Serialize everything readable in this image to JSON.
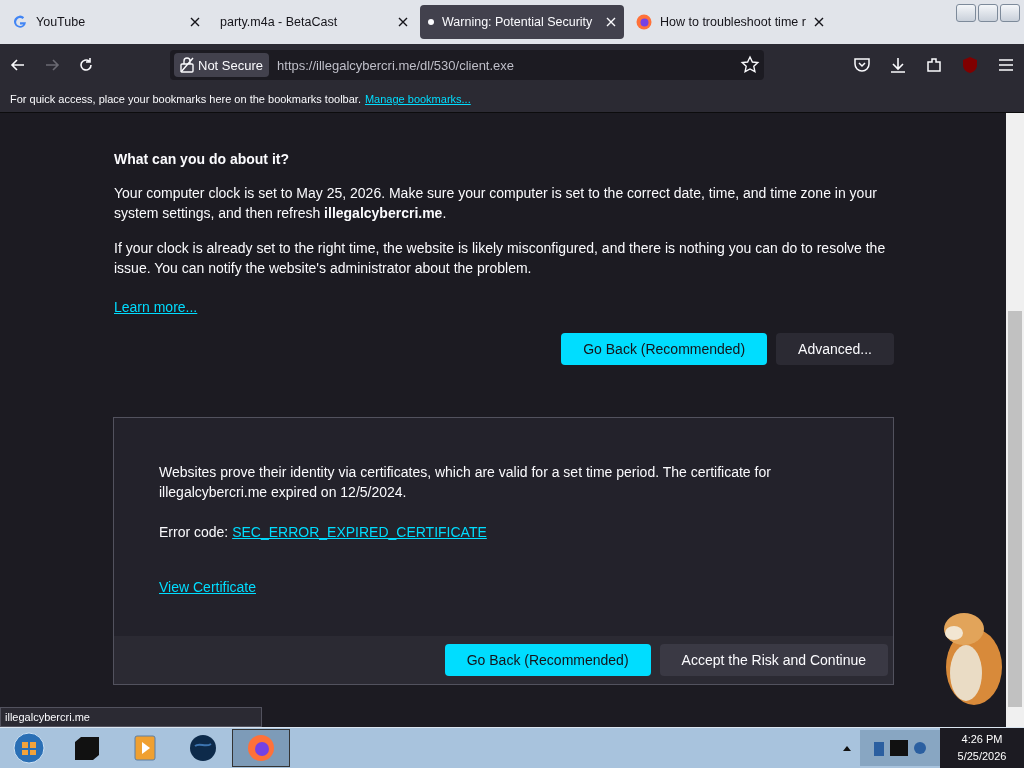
{
  "tabs": [
    {
      "title": "YouTube",
      "kind": "google",
      "selected": false
    },
    {
      "title": "party.m4a - BetaCast",
      "kind": "plain",
      "selected": false
    },
    {
      "title": "Warning: Potential Security",
      "kind": "dot",
      "selected": true
    },
    {
      "title": "How to troubleshoot time r",
      "kind": "firefox",
      "selected": false
    }
  ],
  "toolbar": {
    "security_label": "Not Secure",
    "url": "https://illegalcybercri.me/dl/530/client.exe"
  },
  "bookmarks_bar": {
    "message": "For quick access, place your bookmarks here on the bookmarks toolbar.",
    "link": "Manage bookmarks..."
  },
  "page": {
    "heading": "What can you do about it?",
    "paragraphs": [
      "Your computer clock is set to May 25, 2026. Make sure your computer is set to the correct date, time, and time zone in your system settings, and then refresh **illegalcybercri.me**.",
      "If your clock is already set to the right time, the website is likely misconfigured, and there is nothing you can do to resolve the issue. You can notify the website's administrator about the problem."
    ],
    "learn_more": "Learn more...",
    "buttons": [
      "Go Back (Recommended)",
      "Advanced..."
    ],
    "advanced": {
      "text": "Websites prove their identity via certificates, which are valid for a set time period. The certificate for illegalcybercri.me expired on 12/5/2024.",
      "error_label": "Error code:",
      "error_code": "SEC_ERROR_EXPIRED_CERTIFICATE",
      "view_certificate": "View Certificate",
      "buttons": [
        "Go Back (Recommended)",
        "Accept the Risk and Continue"
      ]
    }
  },
  "status_url": "illegalcybercri.me",
  "taskbar": {
    "apps": [
      {
        "kind": "start"
      },
      {
        "kind": "box"
      },
      {
        "kind": "player"
      },
      {
        "kind": "globe"
      },
      {
        "kind": "firefox",
        "selected": true
      }
    ],
    "time": "4:26 PM",
    "date": "5/25/2026"
  }
}
